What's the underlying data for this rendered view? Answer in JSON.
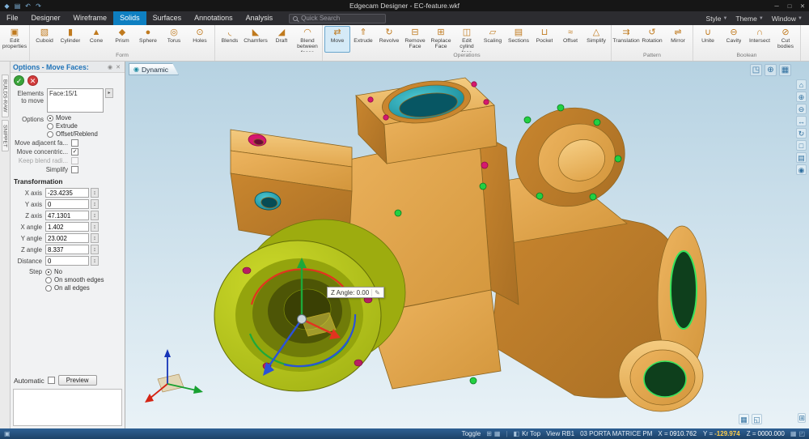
{
  "titlebar": {
    "title": "Edgecam Designer - EC-feature.wkf",
    "quick_access": [
      {
        "name": "app-icon",
        "glyph": "◆"
      },
      {
        "name": "save-icon",
        "glyph": "▤"
      },
      {
        "name": "undo-icon",
        "glyph": "↶"
      },
      {
        "name": "redo-icon",
        "glyph": "↷"
      }
    ],
    "window_controls": [
      {
        "name": "minimize-button",
        "glyph": "─"
      },
      {
        "name": "maximize-button",
        "glyph": "□"
      },
      {
        "name": "close-button",
        "glyph": "✕"
      }
    ]
  },
  "menubar": {
    "tabs": [
      {
        "label": "File",
        "active": false
      },
      {
        "label": "Designer",
        "active": false
      },
      {
        "label": "Wireframe",
        "active": false
      },
      {
        "label": "Solids",
        "active": true
      },
      {
        "label": "Surfaces",
        "active": false
      },
      {
        "label": "Annotations",
        "active": false
      },
      {
        "label": "Analysis",
        "active": false
      }
    ],
    "search_placeholder": "Quick Search",
    "right_items": [
      {
        "label": "Style"
      },
      {
        "label": "Theme"
      },
      {
        "label": "Window"
      }
    ]
  },
  "ribbon": {
    "groups": [
      {
        "label": "",
        "items": [
          {
            "label": "Edit properties",
            "icon": "edit-properties-icon",
            "glyph": "▣",
            "active": false
          }
        ]
      },
      {
        "label": "Form",
        "items": [
          {
            "label": "Cuboid",
            "icon": "cuboid-icon",
            "glyph": "▧",
            "active": false
          },
          {
            "label": "Cylinder",
            "icon": "cylinder-icon",
            "glyph": "▮",
            "active": false
          },
          {
            "label": "Cone",
            "icon": "cone-icon",
            "glyph": "▲",
            "active": false
          },
          {
            "label": "Prism",
            "icon": "prism-icon",
            "glyph": "◆",
            "active": false
          },
          {
            "label": "Sphere",
            "icon": "sphere-icon",
            "glyph": "●",
            "active": false
          },
          {
            "label": "Torus",
            "icon": "torus-icon",
            "glyph": "◎",
            "active": false
          },
          {
            "label": "Holes",
            "icon": "holes-icon",
            "glyph": "⊙",
            "active": false
          }
        ]
      },
      {
        "label": "",
        "items": [
          {
            "label": "Blends",
            "icon": "blends-icon",
            "glyph": "◟",
            "active": false
          },
          {
            "label": "Chamfers",
            "icon": "chamfers-icon",
            "glyph": "◣",
            "active": false
          },
          {
            "label": "Draft",
            "icon": "draft-icon",
            "glyph": "◢",
            "active": false
          },
          {
            "label": "Blend between faces",
            "icon": "blend-between-faces-icon",
            "glyph": "◠",
            "active": false
          }
        ]
      },
      {
        "label": "Operations",
        "items": [
          {
            "label": "Move",
            "icon": "move-icon",
            "glyph": "⇄",
            "active": true
          },
          {
            "label": "Extrude",
            "icon": "extrude-icon",
            "glyph": "⇑",
            "active": false
          },
          {
            "label": "Revolve",
            "icon": "revolve-icon",
            "glyph": "↻",
            "active": false
          },
          {
            "label": "Remove Face",
            "icon": "remove-face-icon",
            "glyph": "⊟",
            "active": false
          },
          {
            "label": "Replace Face",
            "icon": "replace-face-icon",
            "glyph": "⊞",
            "active": false
          },
          {
            "label": "Edit cylind face",
            "icon": "edit-cylind-face-icon",
            "glyph": "◫",
            "active": false
          },
          {
            "label": "Scaling",
            "icon": "scaling-icon",
            "glyph": "▱",
            "active": false
          },
          {
            "label": "Sections",
            "icon": "sections-icon",
            "glyph": "▤",
            "active": false
          },
          {
            "label": "Pocket",
            "icon": "pocket-icon",
            "glyph": "⊔",
            "active": false
          },
          {
            "label": "Offset",
            "icon": "offset-icon",
            "glyph": "≈",
            "active": false
          },
          {
            "label": "Simplify",
            "icon": "simplify-icon",
            "glyph": "△",
            "active": false
          }
        ]
      },
      {
        "label": "Pattern",
        "items": [
          {
            "label": "Translation",
            "icon": "translation-icon",
            "glyph": "⇉",
            "active": false
          },
          {
            "label": "Rotation",
            "icon": "rotation-icon",
            "glyph": "↺",
            "active": false
          },
          {
            "label": "Mirror",
            "icon": "mirror-icon",
            "glyph": "⇌",
            "active": false
          }
        ]
      },
      {
        "label": "Boolean",
        "items": [
          {
            "label": "Unite",
            "icon": "unite-icon",
            "glyph": "∪",
            "active": false
          },
          {
            "label": "Cavity",
            "icon": "cavity-icon",
            "glyph": "⊖",
            "active": false
          },
          {
            "label": "Intersect",
            "icon": "intersect-icon",
            "glyph": "∩",
            "active": false
          },
          {
            "label": "Cut bodies",
            "icon": "cut-bodies-icon",
            "glyph": "⊘",
            "active": false
          }
        ]
      }
    ]
  },
  "side_tabs": [
    {
      "label": "BUILDS-RAW"
    },
    {
      "label": "SNIPPET"
    }
  ],
  "options_panel": {
    "title": "Options - Move Faces:",
    "pin_glyph": "◉",
    "close_glyph": "✕",
    "confirm_glyph": "✓",
    "cancel_glyph": "✕",
    "elements_label": "Elements to move",
    "elements_list": [
      {
        "label": "Face:15/1"
      }
    ],
    "options_label": "Options",
    "mode_radios": [
      {
        "label": "Move",
        "selected": true
      },
      {
        "label": "Extrude",
        "selected": false
      },
      {
        "label": "Offset/Reblend",
        "selected": false
      }
    ],
    "checkboxes": [
      {
        "label": "Move adjacent fa...",
        "checked": false,
        "disabled": false
      },
      {
        "label": "Move concentric...",
        "checked": true,
        "disabled": false
      },
      {
        "label": "Keep blend radi...",
        "checked": false,
        "disabled": true
      },
      {
        "label": "Simplify",
        "checked": false,
        "disabled": false
      }
    ],
    "transformation_label": "Transformation",
    "fields": [
      {
        "label": "X axis",
        "value": "-23.4235"
      },
      {
        "label": "Y axis",
        "value": "0"
      },
      {
        "label": "Z axis",
        "value": "47.1301"
      },
      {
        "label": "X angle",
        "value": "1.402"
      },
      {
        "label": "Y angle",
        "value": "23.002"
      },
      {
        "label": "Z angle",
        "value": "8.337"
      },
      {
        "label": "Distance",
        "value": "0"
      }
    ],
    "step_label": "Step",
    "step_radios": [
      {
        "label": "No",
        "selected": true
      },
      {
        "label": "On smooth edges",
        "selected": false
      },
      {
        "label": "On all edges",
        "selected": false
      }
    ],
    "automatic_label": "Automatic",
    "preview_button": "Preview"
  },
  "viewport": {
    "tab_label": "Dynamic",
    "tab_icon_glyph": "◉",
    "tooltip": "Z Angle: 0.00",
    "top_icons": [
      {
        "name": "view-cube-icon",
        "glyph": "◳"
      },
      {
        "name": "zoom-window-icon",
        "glyph": "⊕"
      },
      {
        "name": "display-mode-icon",
        "glyph": "▦"
      }
    ],
    "right_toolbar": [
      {
        "name": "home-view-icon",
        "glyph": "⌂"
      },
      {
        "name": "zoom-in-icon",
        "glyph": "⊕"
      },
      {
        "name": "zoom-out-icon",
        "glyph": "⊖"
      },
      {
        "name": "pan-icon",
        "glyph": "↔"
      },
      {
        "name": "rotate-view-icon",
        "glyph": "↻"
      },
      {
        "name": "fit-view-icon",
        "glyph": "□"
      },
      {
        "name": "section-view-icon",
        "glyph": "▤"
      },
      {
        "name": "select-icon",
        "glyph": "◉"
      }
    ],
    "bottom_icons": [
      {
        "name": "grid-icon",
        "glyph": "▦"
      },
      {
        "name": "workplane-icon",
        "glyph": "◱"
      }
    ],
    "corner_icon_glyph": "⊞"
  },
  "statusbar": {
    "left_icon_glyph": "▣",
    "toggle_label": "Toggle",
    "toggle_icons": [
      {
        "name": "grid-toggle-icon",
        "glyph": "⊞"
      },
      {
        "name": "plane-toggle-icon",
        "glyph": "▦"
      }
    ],
    "plane_icon_glyph": "◧",
    "plane_label": "Kr Top",
    "view_label": "View RB1",
    "part_label": "03 PORTA MATRICE PM",
    "coords": [
      {
        "label": "X =",
        "value": "0910.762",
        "highlight": false
      },
      {
        "label": "Y =",
        "value": "-129.974",
        "highlight": true
      },
      {
        "label": "Z =",
        "value": "0000.000",
        "highlight": false
      }
    ],
    "right_icons": [
      {
        "name": "display-icon",
        "glyph": "▦"
      },
      {
        "name": "corner-grip-icon",
        "glyph": "◰"
      }
    ]
  },
  "colors": {
    "accent_blue": "#0e7fc1",
    "model_tan": "#d99a3e",
    "selected_face_green": "#b5c41c",
    "bore_teal": "#0f8594",
    "highlight_hole_green": "#22d042",
    "datum_magenta": "#d6186e",
    "coord_highlight": "#ffcf4d"
  }
}
